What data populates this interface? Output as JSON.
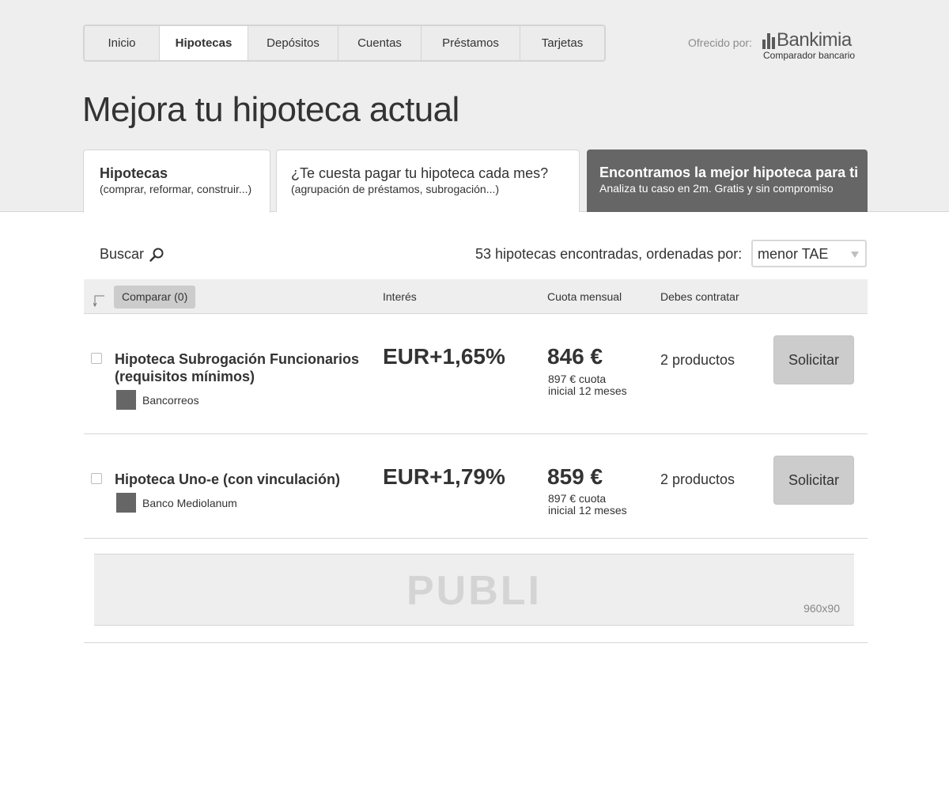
{
  "nav": {
    "items": [
      {
        "label": "Inicio",
        "active": false
      },
      {
        "label": "Hipotecas",
        "active": true
      },
      {
        "label": "Depósitos",
        "active": false
      },
      {
        "label": "Cuentas",
        "active": false
      },
      {
        "label": "Préstamos",
        "active": false
      },
      {
        "label": "Tarjetas",
        "active": false
      }
    ]
  },
  "brand": {
    "offered_by": "Ofrecido por:",
    "name": "Bankimia",
    "subtitle": "Comparador bancario"
  },
  "page_title": "Mejora tu hipoteca actual",
  "product_tabs": [
    {
      "title": "Hipotecas",
      "subtitle": "(comprar, reformar, construir...)"
    },
    {
      "title": "¿Te cuesta pagar tu hipoteca cada mes?",
      "subtitle": "(agrupación de préstamos, subrogación...)"
    },
    {
      "title": "Encontramos la mejor hipoteca para ti",
      "subtitle": "Analiza tu caso en 2m. Gratis y sin compromiso"
    }
  ],
  "toolbar": {
    "search_label": "Buscar",
    "results_text": "53 hipotecas encontradas, ordenadas por:",
    "sort_value": "menor TAE"
  },
  "table": {
    "compare_label": "Comparar (0)",
    "columns": [
      "Interés",
      "Cuota mensual",
      "Debes contratar"
    ],
    "rows": [
      {
        "name_line1": "Hipoteca Subrogación Funcionarios",
        "name_line2": "(requisitos mínimos)",
        "bank": "Bancorreos",
        "rate": "EUR+1,65%",
        "fee": "846 €",
        "fee_note_1": "897 € cuota",
        "fee_note_2": "inicial 12 meses",
        "products": "2 productos",
        "apply_label": "Solicitar"
      },
      {
        "name_line1": "Hipoteca Uno-e (con vinculación)",
        "bank": "Banco Mediolanum",
        "rate": "EUR+1,79%",
        "fee": "859 €",
        "fee_note_1": "897 € cuota",
        "fee_note_2": "inicial 12 meses",
        "products": "2 productos",
        "apply_label": "Solicitar"
      }
    ]
  },
  "ad": {
    "label": "PUBLI",
    "size": "960x90"
  },
  "colors": {
    "header_bg": "#eeeeee",
    "dark_tab_bg": "#666666",
    "button_bg": "#cccccc"
  }
}
